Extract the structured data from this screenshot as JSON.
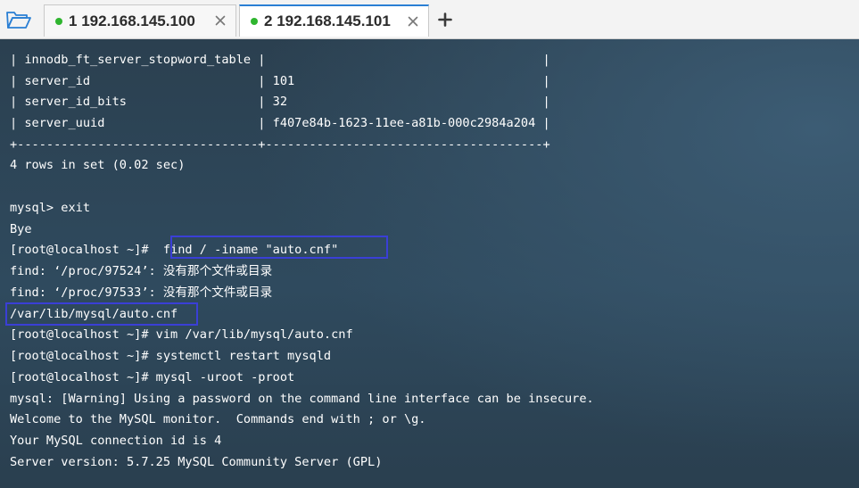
{
  "tabs": [
    {
      "number": "1",
      "host": "192.168.145.100",
      "active": false
    },
    {
      "number": "2",
      "host": "192.168.145.101",
      "active": true
    }
  ],
  "add_tab_label": "+",
  "colors": {
    "status_dot": "#2fb52f",
    "active_tab_accent": "#2a7fd4",
    "highlight_box": "#3a3fd6",
    "terminal_text": "#ffffff"
  },
  "icons": {
    "open": "folder-icon",
    "close": "close-icon",
    "add": "plus-icon"
  },
  "terminal": {
    "lines": [
      "| innodb_ft_server_stopword_table |                                      |",
      "| server_id                       | 101                                  |",
      "| server_id_bits                  | 32                                   |",
      "| server_uuid                     | f407e84b-1623-11ee-a81b-000c2984a204 |",
      "+---------------------------------+--------------------------------------+",
      "4 rows in set (0.02 sec)",
      "",
      "mysql> exit",
      "Bye",
      "[root@localhost ~]#  find / -iname \"auto.cnf\"",
      "find: ‘/proc/97524’: 没有那个文件或目录",
      "find: ‘/proc/97533’: 没有那个文件或目录",
      "/var/lib/mysql/auto.cnf",
      "[root@localhost ~]# vim /var/lib/mysql/auto.cnf",
      "[root@localhost ~]# systemctl restart mysqld",
      "[root@localhost ~]# mysql -uroot -proot",
      "mysql: [Warning] Using a password on the command line interface can be insecure.",
      "Welcome to the MySQL monitor.  Commands end with ; or \\g.",
      "Your MySQL connection id is 4",
      "Server version: 5.7.25 MySQL Community Server (GPL)"
    ]
  }
}
